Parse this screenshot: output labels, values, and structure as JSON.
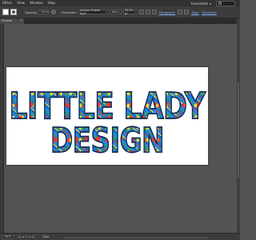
{
  "menubar": {
    "items": [
      "Effect",
      "View",
      "Window",
      "Help"
    ],
    "workspace": "Essentials"
  },
  "controlbar": {
    "opacity_label": "Opacity:",
    "opacity_value": "100%",
    "character_label": "Character:",
    "font_family": "Autumn Puzzle Bold",
    "font_style": "Bold",
    "font_size": "23.21 pt",
    "paragraph_label": "Paragraph:",
    "align_label": "Align",
    "transform_label": "Transform"
  },
  "document": {
    "tab_label": "Preview"
  },
  "artboard": {
    "line1": "LITTLE LADY",
    "line2": "DESIGN"
  },
  "statusbar": {
    "zoom": "50%",
    "nav": "|◂ ◂ 1 ▸ ▸|",
    "tool_label": "Type"
  },
  "colors": {
    "ui_bg": "#535353",
    "menubar_bg": "#323232",
    "controlbar_bg": "#3c3c3c",
    "artboard_bg": "#ffffff",
    "text_outline": "#0d2b55",
    "puzzle_blue": "#1e88e5",
    "puzzle_red": "#e53935",
    "puzzle_yellow": "#fdd835",
    "puzzle_green": "#43a047"
  }
}
